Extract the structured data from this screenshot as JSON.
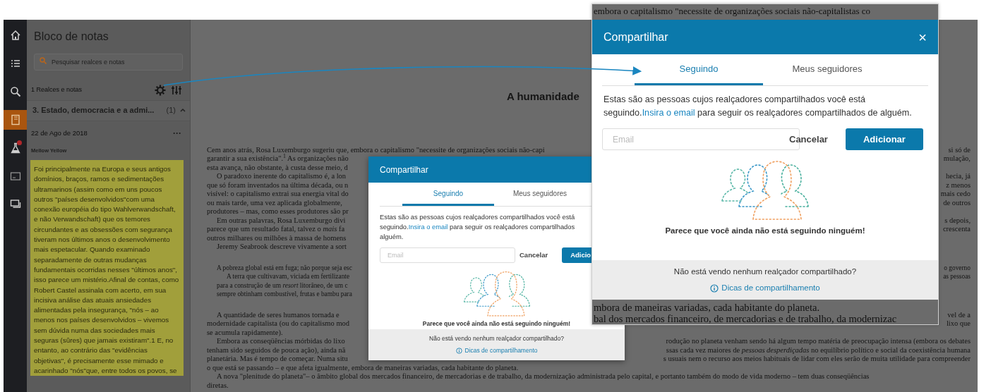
{
  "rail": [
    {
      "selected": false,
      "alert": false
    },
    {
      "selected": false,
      "alert": false
    },
    {
      "selected": false,
      "alert": false
    },
    {
      "selected": true,
      "alert": false
    },
    {
      "selected": false,
      "alert": true
    },
    {
      "selected": false,
      "alert": false
    },
    {
      "selected": false,
      "alert": false
    }
  ],
  "notebook": {
    "title": "Bloco de notas",
    "search": {
      "placeholder": "Pesquisar realces e notas"
    },
    "count": "1 Realces e notas",
    "chapter": {
      "title": "3. Estado, democracia e a admi...",
      "count": "(1)",
      "expanded": true
    },
    "note": {
      "date": "22 de Ago de 2018",
      "menu": "···",
      "color_label": "Mellow Yellow",
      "color": "#a19f3b",
      "text": "Foi principalmente na Europa e seus antigos domínios, braços, ramos e sedimentações ultramarinos (assim como em uns poucos outros \"países desenvolvidos\"com uma conexão européia do tipo Wahlverwandschaft, e não Verwandschaft) que os temores circundantes e as obsessões com segurança tiveram nos últimos anos o desenvolvimento mais espetacular. Quando examinado separadamente de outras mudanças fundamentais ocorridas nesses \"últimos anos\", isso parece um mistério.Afinal de contas, como Robert Castel assinala com acerto, em sua incisiva análise das atuais ansiedades alimentadas pela insegurança, \"nós – ao menos nos países desenvolvidos – vivemos sem dúvida numa das sociedades mais seguras (sûres) que jamais existiram\".1 E, no entanto, ao contrário das \"evidências objetivas\", é precisamente esse mimado e acarinhado \"nós\"que, entre todos os povos, se"
    }
  },
  "document": {
    "heading": "A humanidade",
    "blocks": [
      {
        "kind": "para",
        "lines": [
          {
            "indent": false,
            "left": "Cem anos atrás, Rosa Luxemburgo sugeriu que, embora o capitalismo \"necessite de organizações sociais não-capi",
            "right": "si só de"
          },
          {
            "indent": false,
            "left": "garantir a sua existência\".$^{1}$ As organizações não",
            "right": "mulação,"
          },
          {
            "indent": false,
            "left": "esta avança, não obstante, à custa desse meio, d"
          },
          {
            "indent": true,
            "left": "O paradoxo inerente do capitalismo é, a lon",
            "right": "hecia, já"
          },
          {
            "indent": false,
            "left": "que só foram inventados na última década, ou n",
            "right": "z menos"
          },
          {
            "indent": false,
            "left": "visível: o capitalismo extrai sua energia vital do",
            "right": "mais cedo"
          },
          {
            "indent": false,
            "left": "ou mais tarde, uma vez aplicada globalmente,",
            "right": "de outros"
          },
          {
            "indent": false,
            "left": "produtores – mas, como esses produtores são pr"
          },
          {
            "indent": true,
            "left": "Em outras palavras, Rosa Luxemburgo divi",
            "right": "s depois,"
          },
          {
            "indent": false,
            "left": "parece que um resultado fatal, talvez o *mais* fa",
            "right": "crescenta"
          },
          {
            "indent": false,
            "left": "outros milhares ou milhões à massa de homens"
          },
          {
            "indent": true,
            "left": "Jeremy Seabrook descreve vivamente a sort"
          }
        ]
      },
      {
        "kind": "quote",
        "lines": [
          {
            "indent": false,
            "left": "A pobreza global está em fuga; não porque seja esc",
            "right": "o governo"
          },
          {
            "indent": true,
            "left": "A terra que cultivavam, viciada em fertilizante",
            "right": "as pessoas"
          },
          {
            "indent": false,
            "left": "para a construção de um *resort* litorâneo, de um c"
          },
          {
            "indent": false,
            "left": "sempre obtinham combustível, frutas e bambu para"
          }
        ]
      },
      {
        "kind": "para",
        "lines": [
          {
            "indent": true,
            "left": "A quantidade de seres humanos tornada e",
            "right": "vel de a"
          },
          {
            "indent": false,
            "left": "modernidade capitalista (ou do capitalismo mod",
            "right": "lixo que"
          },
          {
            "indent": false,
            "left": "se acumula rapidamente)."
          },
          {
            "indent": true,
            "left": "Embora as conseqüências mórbidas do lixo",
            "right": "rodução no planeta venham sendo há algum tempo matéria de preocupação intensa (embora os debates"
          },
          {
            "indent": false,
            "left": "tenham sido seguidos de pouca ação), ainda nã",
            "right": "ssas cada vez maiores de *pessoas desperdiçadas* no equilíbrio político e social da coexistência humana"
          },
          {
            "indent": false,
            "left": "planetária. Mas é tempo de começar. Numa situ",
            "right": "s usuais nem o recurso aos meios habituais de lidar com eles serão de muita utilidade para compreender"
          },
          {
            "indent": false,
            "left": "o que está se passando – e que afeta igualmente, embora de maneiras variadas, cada habitante do planeta."
          },
          {
            "indent": true,
            "left": "A nova \"plenitude do planeta\"– o âmbito global dos mercados financeiro, de mercadorias e de trabalho, da modernização administrada pelo capital, e portanto também do modo de vida moderno – tem duas conseqüências"
          },
          {
            "indent": false,
            "left": "diretas."
          }
        ]
      }
    ]
  },
  "small_dialog": {
    "title": "Compartilhar",
    "tabs": [
      {
        "label": "Seguindo",
        "selected": true
      },
      {
        "label": "Meus seguidores",
        "selected": false
      }
    ],
    "intro": {
      "before": "Estas são as pessoas cujos realçadores compartilhados você está seguindo.",
      "link": "Insira o email",
      "after": "para seguir os realçadores compartilhados",
      "tail": "alguém."
    },
    "email": {
      "placeholder": "Email"
    },
    "cancel": "Cancelar",
    "add": "Adicio",
    "empty_message": "Parece que você ainda não está seguindo ninguém!",
    "footer": {
      "question": "Não está vendo nenhum realçador compartilhado?",
      "tips": "Dicas de compartilhamento"
    }
  },
  "callout": {
    "top_text": "embora o capitalismo \"necessite de organizações sociais não-capitalistas co",
    "dialog": {
      "title": "Compartilhar",
      "close": "×",
      "tabs": [
        {
          "label": "Seguindo",
          "selected": true
        },
        {
          "label": "Meus seguidores",
          "selected": false
        }
      ],
      "intro": {
        "before": "Estas são as pessoas cujos realçadores compartilhados você está seguindo.",
        "link": "Insira o email",
        "after": "para seguir os realçadores compartilhados de alguém."
      },
      "email": {
        "placeholder": "Email"
      },
      "cancel": "Cancelar",
      "add": "Adicionar",
      "empty_message": "Parece que você ainda não está seguindo ninguém!",
      "footer": {
        "question": "Não está vendo nenhum realçador compartilhado?",
        "tips": "Dicas de compartilhamento"
      }
    },
    "bottom_lines": [
      "mbora de maneiras variadas, cada habitante do planeta.",
      "bal dos mercados financeiro, de mercadorias e de trabalho, da modernizac"
    ]
  }
}
